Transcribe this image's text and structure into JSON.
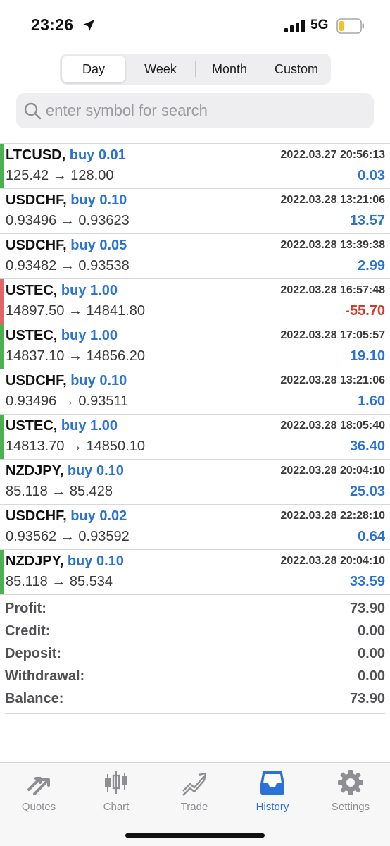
{
  "status_bar": {
    "time": "23:26",
    "network": "5G",
    "icons": [
      "location-arrow-icon",
      "cellular-signal-icon",
      "battery-low-icon"
    ]
  },
  "period_tabs": [
    {
      "label": "Day",
      "selected": true
    },
    {
      "label": "Week",
      "selected": false
    },
    {
      "label": "Month",
      "selected": false
    },
    {
      "label": "Custom",
      "selected": false
    }
  ],
  "search": {
    "placeholder": "enter symbol for search",
    "value": ""
  },
  "colors": {
    "accent": "#2a72d6",
    "profit": "#2a72d6",
    "loss": "#d33a2c",
    "bar_profit": "#4caf50",
    "bar_loss": "#e06666"
  },
  "deals": [
    {
      "symbol": "LTCUSD",
      "side": "buy 0.01",
      "time": "2022.03.27 20:56:13",
      "open": "125.42",
      "close": "128.00",
      "profit": "0.03",
      "result": "profit",
      "marker": true
    },
    {
      "symbol": "USDCHF",
      "side": "buy 0.10",
      "time": "2022.03.28 13:21:06",
      "open": "0.93496",
      "close": "0.93623",
      "profit": "13.57",
      "result": "profit",
      "marker": false
    },
    {
      "symbol": "USDCHF",
      "side": "buy 0.05",
      "time": "2022.03.28 13:39:38",
      "open": "0.93482",
      "close": "0.93538",
      "profit": "2.99",
      "result": "profit",
      "marker": false
    },
    {
      "symbol": "USTEC",
      "side": "buy 1.00",
      "time": "2022.03.28 16:57:48",
      "open": "14897.50",
      "close": "14841.80",
      "profit": "-55.70",
      "result": "loss",
      "marker": true
    },
    {
      "symbol": "USTEC",
      "side": "buy 1.00",
      "time": "2022.03.28 17:05:57",
      "open": "14837.10",
      "close": "14856.20",
      "profit": "19.10",
      "result": "profit",
      "marker": true
    },
    {
      "symbol": "USDCHF",
      "side": "buy 0.10",
      "time": "2022.03.28 13:21:06",
      "open": "0.93496",
      "close": "0.93511",
      "profit": "1.60",
      "result": "profit",
      "marker": false
    },
    {
      "symbol": "USTEC",
      "side": "buy 1.00",
      "time": "2022.03.28 18:05:40",
      "open": "14813.70",
      "close": "14850.10",
      "profit": "36.40",
      "result": "profit",
      "marker": true
    },
    {
      "symbol": "NZDJPY",
      "side": "buy 0.10",
      "time": "2022.03.28 20:04:10",
      "open": "85.118",
      "close": "85.428",
      "profit": "25.03",
      "result": "profit",
      "marker": false
    },
    {
      "symbol": "USDCHF",
      "side": "buy 0.02",
      "time": "2022.03.28 22:28:10",
      "open": "0.93562",
      "close": "0.93592",
      "profit": "0.64",
      "result": "profit",
      "marker": false
    },
    {
      "symbol": "NZDJPY",
      "side": "buy 0.10",
      "time": "2022.03.28 20:04:10",
      "open": "85.118",
      "close": "85.534",
      "profit": "33.59",
      "result": "profit",
      "marker": true
    }
  ],
  "arrow": "→",
  "summary": [
    {
      "label": "Profit:",
      "value": "73.90"
    },
    {
      "label": "Credit:",
      "value": "0.00"
    },
    {
      "label": "Deposit:",
      "value": "0.00"
    },
    {
      "label": "Withdrawal:",
      "value": "0.00"
    },
    {
      "label": "Balance:",
      "value": "73.90"
    }
  ],
  "tabbar": [
    {
      "label": "Quotes",
      "icon": "quotes-arrows-icon",
      "active": false
    },
    {
      "label": "Chart",
      "icon": "candlestick-chart-icon",
      "active": false
    },
    {
      "label": "Trade",
      "icon": "trade-trend-icon",
      "active": false
    },
    {
      "label": "History",
      "icon": "history-inbox-icon",
      "active": true
    },
    {
      "label": "Settings",
      "icon": "settings-gear-icon",
      "active": false
    }
  ]
}
